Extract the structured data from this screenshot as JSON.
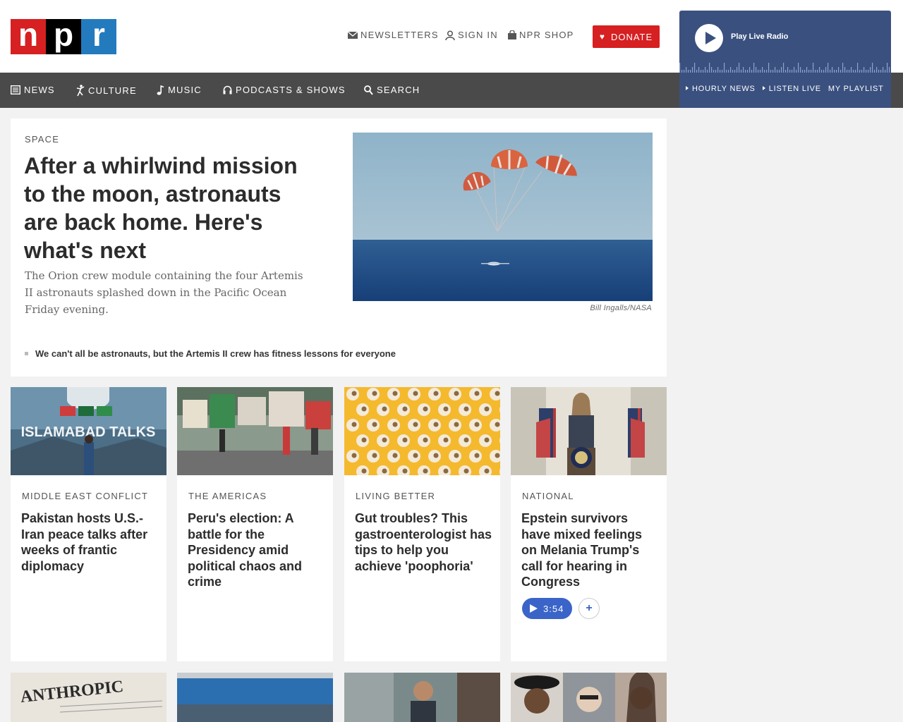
{
  "logo": {
    "letters": [
      "n",
      "p",
      "r"
    ]
  },
  "utility": {
    "newsletters": "NEWSLETTERS",
    "sign_in": "SIGN IN",
    "shop": "NPR SHOP",
    "donate": "DONATE"
  },
  "player": {
    "label": "Play Live Radio",
    "links": [
      "HOURLY NEWS",
      "LISTEN LIVE",
      "MY PLAYLIST"
    ]
  },
  "nav": {
    "items": [
      "NEWS",
      "CULTURE",
      "MUSIC",
      "PODCASTS & SHOWS",
      "SEARCH"
    ]
  },
  "colors": {
    "brand_red": "#d62021",
    "brand_blue": "#237bbd",
    "player_blue": "#3a507f",
    "nav_gray": "#4a4a4a",
    "audio_blue": "#3a64c8"
  },
  "lead": {
    "slug": "SPACE",
    "title": "After a whirlwind mission to the moon, astronauts are back home. Here's what's next",
    "teaser": "The Orion crew module containing the four Artemis II astronauts splashed down in the Pacific Ocean Friday evening.",
    "credit": "Bill Ingalls/NASA",
    "related": "We can't all be astronauts, but the Artemis II crew has fitness lessons for everyone"
  },
  "stories": [
    {
      "slug": "MIDDLE EAST CONFLICT",
      "title": "Pakistan hosts U.S.-Iran peace talks after weeks of frantic diplomacy",
      "image_text": "ISLAMABAD TALKS"
    },
    {
      "slug": "THE AMERICAS",
      "title": "Peru's election: A battle for the Presidency amid political chaos and crime"
    },
    {
      "slug": "LIVING BETTER",
      "title": "Gut troubles? This gastroenterologist has tips to help you achieve 'poophoria'"
    },
    {
      "slug": "NATIONAL",
      "title": "Epstein survivors have mixed feelings on Melania Trump's call for hearing in Congress",
      "audio": "3:54",
      "add": "+"
    }
  ],
  "row2": {
    "first_image_text": "ANTHROPIC"
  }
}
